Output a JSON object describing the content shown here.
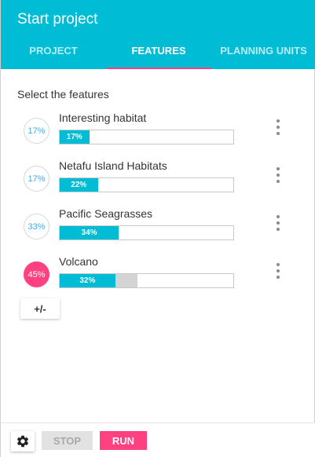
{
  "header": {
    "title": "Start project"
  },
  "tabs": [
    {
      "label": "PROJECT",
      "active": false
    },
    {
      "label": "FEATURES",
      "active": true
    },
    {
      "label": "PLANNING UNITS",
      "active": false
    }
  ],
  "section_label": "Select the features",
  "features": [
    {
      "name": "Interesting habitat",
      "badge": "17%",
      "bar_label": "17%",
      "protected_percent": 17,
      "target_percent": 17,
      "badge_highlight": false
    },
    {
      "name": "Netafu Island Habitats",
      "badge": "17%",
      "bar_label": "22%",
      "protected_percent": 22,
      "target_percent": 17,
      "badge_highlight": false
    },
    {
      "name": "Pacific Seagrasses",
      "badge": "33%",
      "bar_label": "34%",
      "protected_percent": 34,
      "target_percent": 33,
      "badge_highlight": false
    },
    {
      "name": "Volcano",
      "badge": "45%",
      "bar_label": "32%",
      "protected_percent": 32,
      "target_percent": 45,
      "badge_highlight": true
    }
  ],
  "add_remove_label": "+/-",
  "footer": {
    "settings_icon": "gear-icon",
    "stop_label": "STOP",
    "run_label": "RUN"
  },
  "colors": {
    "header": "#00bcd4",
    "accent": "#ff4081",
    "bar_fill": "#00bcd4",
    "bar_shortfall": "#d4d4d4"
  }
}
